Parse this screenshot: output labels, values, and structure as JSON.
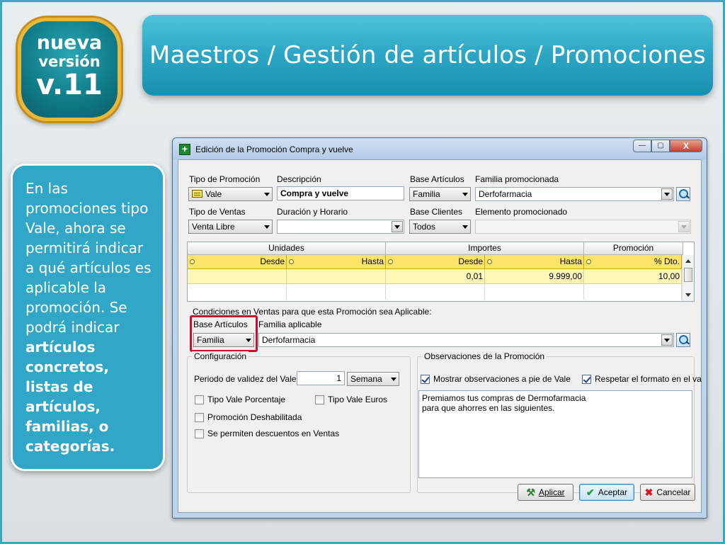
{
  "logo": {
    "line1": "nueva",
    "line2": "versión",
    "line3": "v.11"
  },
  "slide_title": "Maestros / Gestión de artículos / Promociones",
  "note": {
    "text_plain": "En las promociones tipo Vale, ahora se permitirá indicar a qué artículos es aplicable la promoción.  Se podrá indicar",
    "text_bold": "artículos concretos, listas de artículos, familias, o categorías."
  },
  "window": {
    "title": "Edición de la Promoción Compra y vuelve",
    "controls": {
      "minimize": "—",
      "maximize": "▢",
      "close": "X"
    },
    "fields": {
      "tipo_promocion": {
        "label": "Tipo de Promoción",
        "value": "Vale",
        "icon": "vale-ticket-icon"
      },
      "descripcion": {
        "label": "Descripción",
        "value": "Compra y vuelve"
      },
      "base_articulos": {
        "label": "Base Artículos",
        "value": "Familia"
      },
      "familia_promocionada": {
        "label": "Familia promocionada",
        "value": "Derfofarmacia"
      },
      "tipo_ventas": {
        "label": "Tipo de Ventas",
        "value": "Venta Libre"
      },
      "duracion_horario": {
        "label": "Duración y Horario",
        "value": ""
      },
      "base_clientes": {
        "label": "Base Clientes",
        "value": "Todos"
      },
      "elemento_promocionado": {
        "label": "Elemento promocionado",
        "value": ""
      }
    },
    "grid": {
      "groups": [
        "Unidades",
        "Importes",
        "Promoción"
      ],
      "columns": [
        "Desde",
        "Hasta",
        "Desde",
        "Hasta",
        "% Dto."
      ],
      "rows": [
        [
          "",
          "",
          "0,01",
          "9.999,00",
          "10,00"
        ]
      ]
    },
    "conditions": {
      "title": "Condiciones en Ventas para que esta Promoción sea Aplicable:",
      "base_label": "Base Artículos",
      "base_value": "Familia",
      "familia_label": "Familia aplicable",
      "familia_value": "Derfofarmacia"
    },
    "config": {
      "title": "Configuración",
      "periodo_label": "Periodo de validez del Vale:",
      "periodo_value": "1",
      "periodo_unit": "Semana",
      "checks": [
        {
          "label": "Tipo Vale Porcentaje",
          "checked": false
        },
        {
          "label": "Tipo Vale Euros",
          "checked": false
        },
        {
          "label": "Promoción Deshabilitada",
          "checked": false
        },
        {
          "label": "Se permiten descuentos en Ventas",
          "checked": false
        }
      ]
    },
    "observaciones": {
      "title": "Observaciones de la Promoción",
      "mostrar_label": "Mostrar observaciones a pie de Vale",
      "respetar_label": "Respetar el formato en el va",
      "text": "Premiamos tus compras de Dermofarmacia\npara que ahorres en las siguientes."
    },
    "buttons": {
      "aplicar": "Aplicar",
      "aceptar": "Aceptar",
      "cancelar": "Cancelar"
    }
  }
}
